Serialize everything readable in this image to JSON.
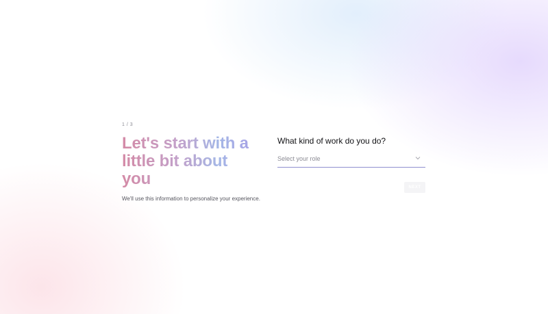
{
  "onboarding": {
    "step": "1 / 3",
    "headline": "Let's start with a little bit about you",
    "subtext": "We'll use this information to personalize your experience.",
    "question": "What kind of work do you do?",
    "role_select": {
      "placeholder": "Select your role",
      "icon": "chevron-down-icon"
    },
    "next_label": "NEXT"
  },
  "colors": {
    "headline_gradient": [
      "#d48aa6",
      "#c3a0c9",
      "#a5b7e6",
      "#a79ee6"
    ],
    "select_underline": "#8f8fcf",
    "next_button_bg": "#f4f4f6"
  }
}
